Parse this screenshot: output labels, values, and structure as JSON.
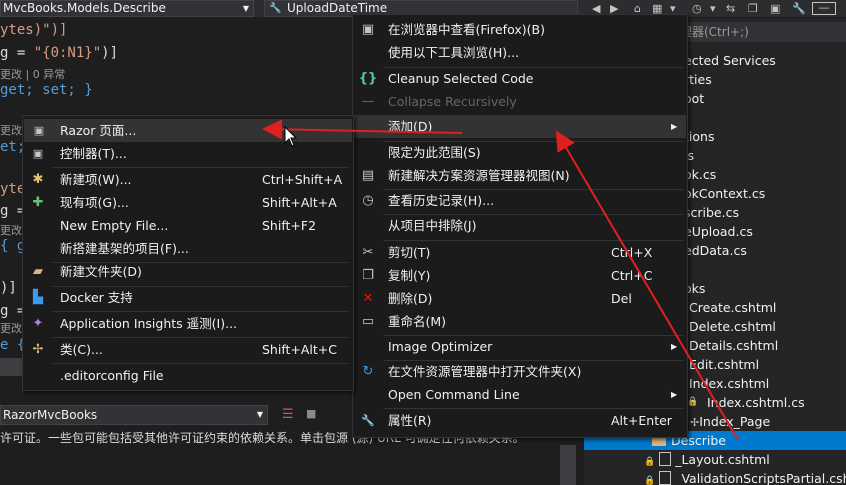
{
  "navbar": {
    "left_combo": "MvcBooks.Models.Describe",
    "right_combo": "UploadDateTime",
    "search_hint": "管理器(Ctrl+;)"
  },
  "editor": {
    "lines": [
      {
        "a": "ytes)\")]",
        "cls": "str"
      },
      {
        "a": "g = ",
        "b": "\"{0:N1}\"",
        "c": ")]"
      },
      {
        "lens": "更改 | 0 异常"
      },
      {
        "kw": "get; set; }"
      },
      {
        "lens": "更改"
      },
      {
        "kw": "et; s"
      },
      {
        "str": "yte"
      },
      {
        "a": "g = "
      },
      {
        "lens": "更改"
      },
      {
        "kw": "{ ge"
      },
      {
        "a": ")]"
      },
      {
        "a": "g = "
      },
      {
        "lens": "更改"
      },
      {
        "kw": "e { "
      }
    ],
    "project_combo": "RazorMvcBooks",
    "license_text": "许可证。一些包可能包括受其他许可证约束的依赖关系。单击包源 (源) URL 可确定任何依赖关系。"
  },
  "solution_explorer": {
    "items": [
      "ected Services",
      "rties",
      "oot",
      "tions",
      "ls",
      "ok.cs",
      "okContext.cs",
      "scribe.cs",
      "eUpload.cs",
      "edData.cs",
      "oks",
      "Create.cshtml",
      "Delete.cshtml",
      "Details.cshtml",
      "Edit.cshtml",
      "Index.cshtml",
      "Index.cshtml.cs",
      "Index_Page",
      "Describe",
      "_Layout.cshtml",
      "_ValidationScriptsPartial.cshtml"
    ]
  },
  "context_menu": {
    "items": [
      {
        "icon": "browser-icon",
        "glyph": "▣",
        "label": "在浏览器中查看(Firefox)(B)",
        "shortcut": ""
      },
      {
        "icon": "",
        "glyph": "",
        "label": "使用以下工具浏览(H)...",
        "shortcut": ""
      },
      {
        "icon": "braces-icon",
        "glyph": "{}",
        "label": "Cleanup Selected Code",
        "shortcut": ""
      },
      {
        "icon": "collapse-icon",
        "glyph": "—",
        "label": "Collapse Recursively",
        "shortcut": "",
        "disabled": true
      },
      {
        "icon": "",
        "glyph": "",
        "label": "添加(D)",
        "shortcut": "",
        "submenu": true
      },
      {
        "icon": "",
        "glyph": "",
        "label": "限定为此范围(S)",
        "shortcut": ""
      },
      {
        "icon": "new-view-icon",
        "glyph": "▤",
        "label": "新建解决方案资源管理器视图(N)",
        "shortcut": ""
      },
      {
        "icon": "history-icon",
        "glyph": "◷",
        "label": "查看历史记录(H)...",
        "shortcut": ""
      },
      {
        "icon": "",
        "glyph": "",
        "label": "从项目中排除(J)",
        "shortcut": ""
      },
      {
        "icon": "cut-icon",
        "glyph": "✂",
        "label": "剪切(T)",
        "shortcut": "Ctrl+X"
      },
      {
        "icon": "copy-icon",
        "glyph": "❐",
        "label": "复制(Y)",
        "shortcut": "Ctrl+C"
      },
      {
        "icon": "delete-icon",
        "glyph": "✕",
        "label": "删除(D)",
        "shortcut": "Del"
      },
      {
        "icon": "rename-icon",
        "glyph": "▭",
        "label": "重命名(M)",
        "shortcut": ""
      },
      {
        "icon": "",
        "glyph": "",
        "label": "Image Optimizer",
        "shortcut": "",
        "submenu": true
      },
      {
        "icon": "open-folder-icon",
        "glyph": "↻",
        "label": "在文件资源管理器中打开文件夹(X)",
        "shortcut": ""
      },
      {
        "icon": "",
        "glyph": "",
        "label": "Open Command Line",
        "shortcut": "",
        "submenu": true
      },
      {
        "icon": "wrench-icon",
        "glyph": "🔧",
        "label": "属性(R)",
        "shortcut": "Alt+Enter"
      }
    ]
  },
  "add_submenu": {
    "items": [
      {
        "icon": "razor-page-icon",
        "glyph": "▣",
        "label": "Razor 页面...",
        "shortcut": ""
      },
      {
        "icon": "controller-icon",
        "glyph": "▣",
        "label": "控制器(T)...",
        "shortcut": ""
      },
      {
        "icon": "new-item-icon",
        "glyph": "✱",
        "label": "新建项(W)...",
        "shortcut": "Ctrl+Shift+A"
      },
      {
        "icon": "existing-item-icon",
        "glyph": "✚",
        "label": "现有项(G)...",
        "shortcut": "Shift+Alt+A"
      },
      {
        "icon": "",
        "glyph": "",
        "label": "New Empty File...",
        "shortcut": "Shift+F2"
      },
      {
        "icon": "",
        "glyph": "",
        "label": "新搭建基架的项目(F)...",
        "shortcut": ""
      },
      {
        "icon": "new-folder-icon",
        "glyph": "▰",
        "label": "新建文件夹(D)",
        "shortcut": ""
      },
      {
        "icon": "docker-icon",
        "glyph": "▙",
        "label": "Docker 支持",
        "shortcut": ""
      },
      {
        "icon": "insights-icon",
        "glyph": "✦",
        "label": "Application Insights 遥测(I)...",
        "shortcut": ""
      },
      {
        "icon": "class-icon",
        "glyph": "✢",
        "label": "类(C)...",
        "shortcut": "Shift+Alt+C"
      },
      {
        "icon": "",
        "glyph": "",
        "label": ".editorconfig File",
        "shortcut": ""
      }
    ]
  },
  "colors": {
    "accent_selection": "#007acc",
    "annotation_arrow": "#e02020",
    "menu_bg": "#1b1b1c"
  }
}
